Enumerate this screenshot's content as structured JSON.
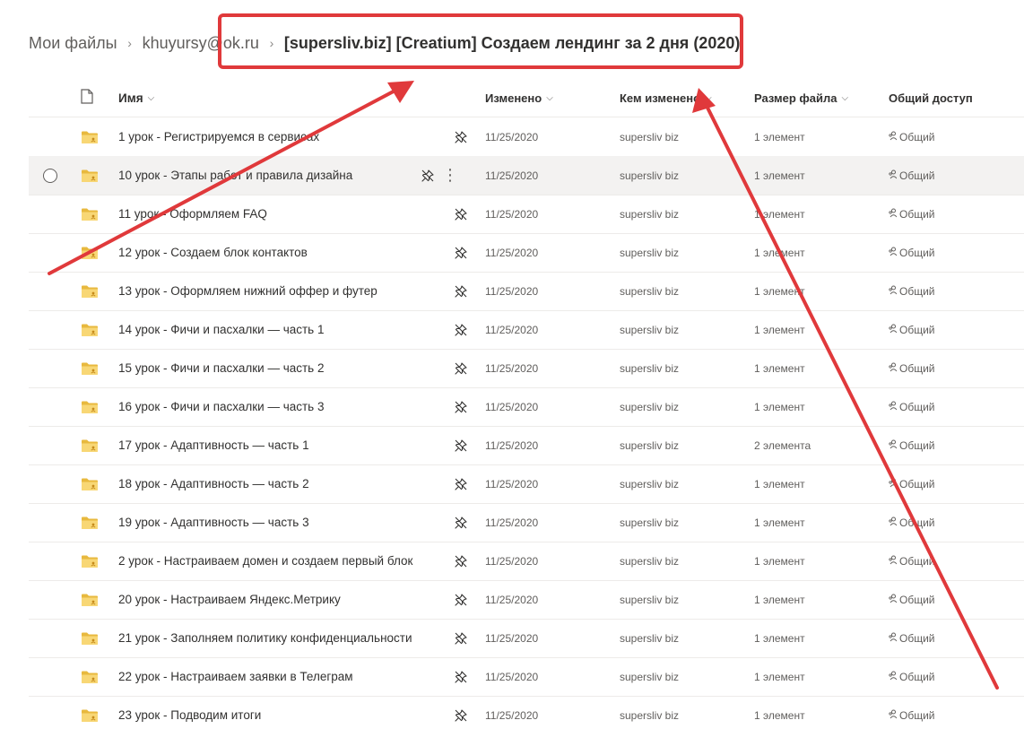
{
  "breadcrumb": {
    "items": [
      {
        "label": "Мои файлы"
      },
      {
        "label": "khuyursy@ok.ru"
      },
      {
        "label": "[supersliv.biz] [Creatium] Создаем лендинг за 2 дня (2020)"
      }
    ],
    "separator": "›"
  },
  "columns": {
    "name": "Имя",
    "modified": "Изменено",
    "modified_by": "Кем изменено",
    "file_size": "Размер файла",
    "sharing": "Общий доступ"
  },
  "icons": {
    "file_type": "document-icon",
    "folder": "folder-icon",
    "pin": "pin-icon",
    "more": "more-vertical-icon",
    "shared": "people-icon"
  },
  "colors": {
    "annotation": "#e0393b",
    "folder": "#f8d775",
    "folder_dark": "#e8b93e"
  },
  "rows": [
    {
      "name": "1 урок - Регистрируемся в сервисах",
      "modified": "11/25/2020",
      "modified_by": "supersliv biz",
      "size": "1 элемент",
      "sharing": "Общий"
    },
    {
      "name": "10 урок - Этапы работ и правила дизайна",
      "modified": "11/25/2020",
      "modified_by": "supersliv biz",
      "size": "1 элемент",
      "sharing": "Общий",
      "hover": true
    },
    {
      "name": "11 урок - Оформляем FAQ",
      "modified": "11/25/2020",
      "modified_by": "supersliv biz",
      "size": "1 элемент",
      "sharing": "Общий"
    },
    {
      "name": "12 урок - Создаем блок контактов",
      "modified": "11/25/2020",
      "modified_by": "supersliv biz",
      "size": "1 элемент",
      "sharing": "Общий"
    },
    {
      "name": "13 урок - Оформляем нижний оффер и футер",
      "modified": "11/25/2020",
      "modified_by": "supersliv biz",
      "size": "1 элемент",
      "sharing": "Общий"
    },
    {
      "name": "14 урок - Фичи и пасхалки — часть 1",
      "modified": "11/25/2020",
      "modified_by": "supersliv biz",
      "size": "1 элемент",
      "sharing": "Общий"
    },
    {
      "name": "15 урок - Фичи и пасхалки — часть 2",
      "modified": "11/25/2020",
      "modified_by": "supersliv biz",
      "size": "1 элемент",
      "sharing": "Общий"
    },
    {
      "name": "16 урок - Фичи и пасхалки — часть 3",
      "modified": "11/25/2020",
      "modified_by": "supersliv biz",
      "size": "1 элемент",
      "sharing": "Общий"
    },
    {
      "name": "17 урок - Адаптивность — часть 1",
      "modified": "11/25/2020",
      "modified_by": "supersliv biz",
      "size": "2 элемента",
      "sharing": "Общий"
    },
    {
      "name": "18 урок - Адаптивность — часть 2",
      "modified": "11/25/2020",
      "modified_by": "supersliv biz",
      "size": "1 элемент",
      "sharing": "Общий"
    },
    {
      "name": "19 урок - Адаптивность — часть 3",
      "modified": "11/25/2020",
      "modified_by": "supersliv biz",
      "size": "1 элемент",
      "sharing": "Общий"
    },
    {
      "name": "2 урок - Настраиваем домен и создаем первый блок",
      "modified": "11/25/2020",
      "modified_by": "supersliv biz",
      "size": "1 элемент",
      "sharing": "Общий"
    },
    {
      "name": "20 урок - Настраиваем Яндекс.Метрику",
      "modified": "11/25/2020",
      "modified_by": "supersliv biz",
      "size": "1 элемент",
      "sharing": "Общий"
    },
    {
      "name": "21 урок - Заполняем политику конфиденциальности",
      "modified": "11/25/2020",
      "modified_by": "supersliv biz",
      "size": "1 элемент",
      "sharing": "Общий"
    },
    {
      "name": "22 урок - Настраиваем заявки в Телеграм",
      "modified": "11/25/2020",
      "modified_by": "supersliv biz",
      "size": "1 элемент",
      "sharing": "Общий"
    },
    {
      "name": "23 урок - Подводим итоги",
      "modified": "11/25/2020",
      "modified_by": "supersliv biz",
      "size": "1 элемент",
      "sharing": "Общий"
    }
  ]
}
